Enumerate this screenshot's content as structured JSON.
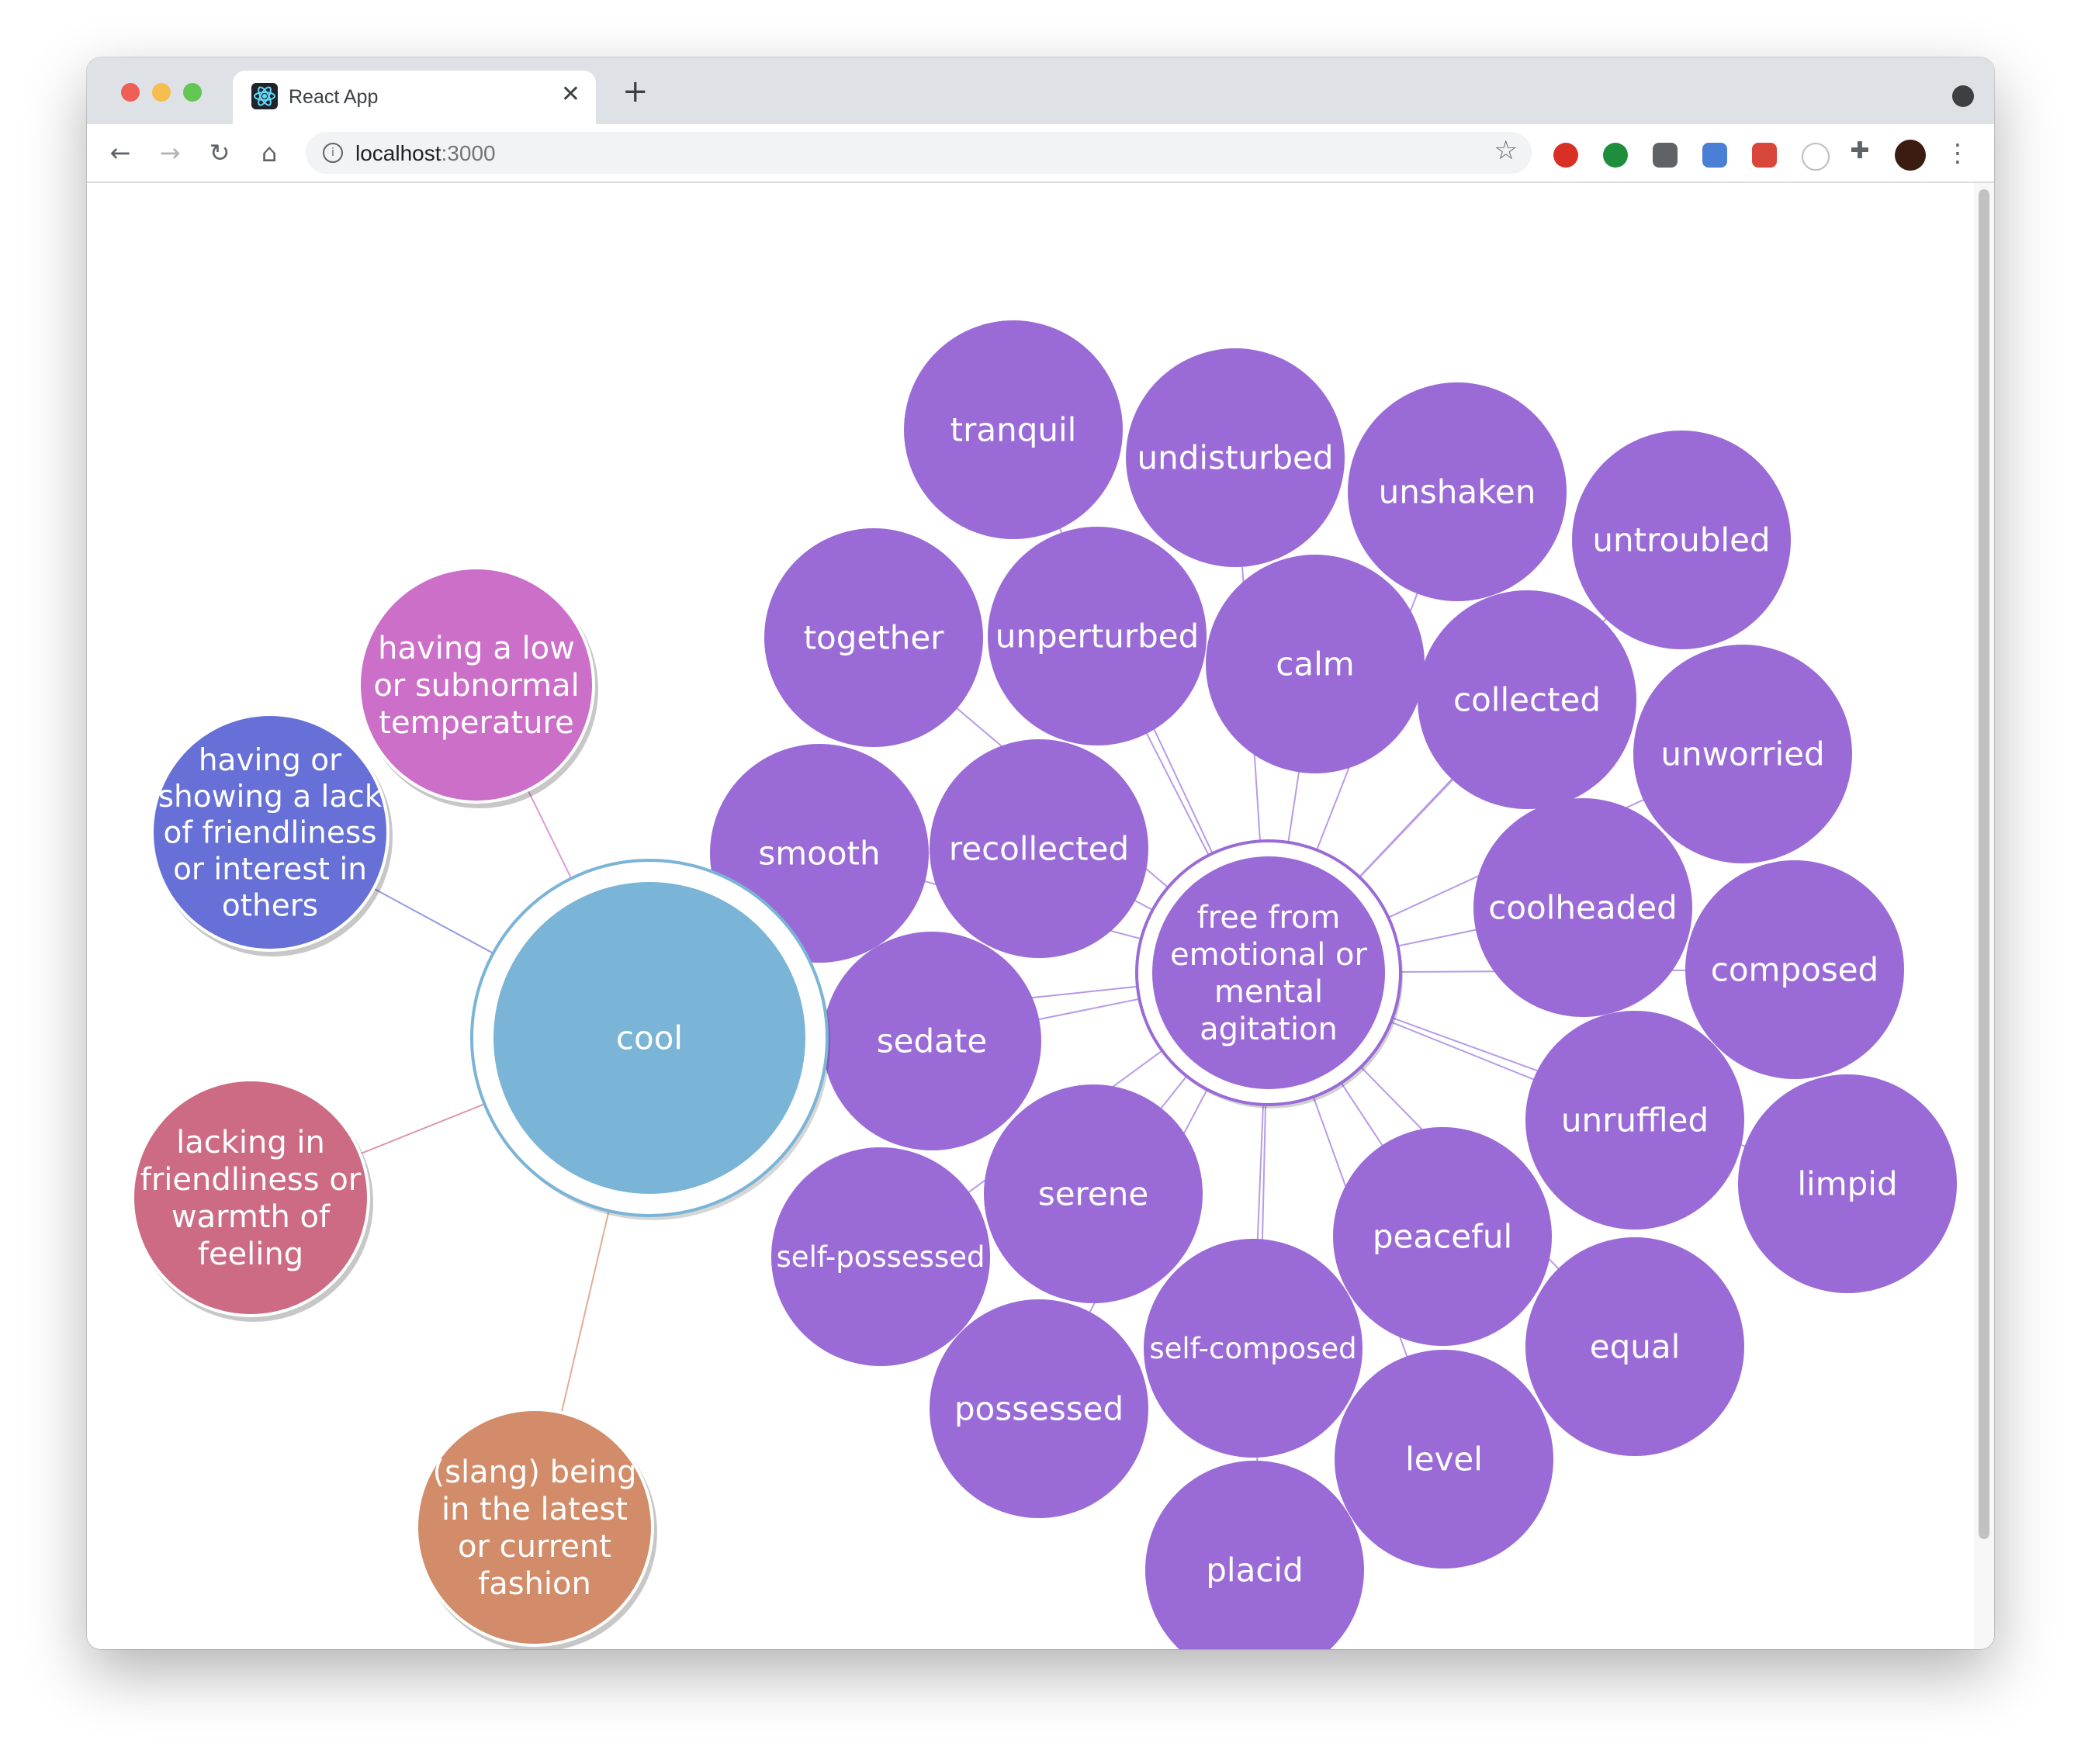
{
  "browser": {
    "tab_title": "React App",
    "url_host": "localhost",
    "url_port": ":3000"
  },
  "graph": {
    "root": {
      "label": "cool",
      "color": "#7ab4d6"
    },
    "senses": [
      {
        "id": "s-temp",
        "lines": [
          "having a low",
          "or subnormal",
          "temperature"
        ],
        "color": "#cc6fc9"
      },
      {
        "id": "s-lack",
        "lines": [
          "having or",
          "showing a lack",
          "of friendliness",
          "or interest in",
          "others"
        ],
        "color": "#6670d6"
      },
      {
        "id": "s-warm",
        "lines": [
          "lacking in",
          "friendliness or",
          "warmth of",
          "feeling"
        ],
        "color": "#cd6b84"
      },
      {
        "id": "s-slang",
        "lines": [
          "(slang) being",
          "in the latest",
          "or current",
          "fashion"
        ],
        "color": "#d38c69"
      },
      {
        "id": "s-calm",
        "lines": [
          "free from",
          "emotional or",
          "mental",
          "agitation"
        ],
        "color": "#9a6bd6"
      }
    ],
    "synonyms": [
      "tranquil",
      "undisturbed",
      "unshaken",
      "untroubled",
      "together",
      "unperturbed",
      "calm",
      "collected",
      "unworried",
      "smooth",
      "recollected",
      "coolheaded",
      "composed",
      "sedate",
      "unruffled",
      "limpid",
      "serene",
      "self-possessed",
      "peaceful",
      "equal",
      "self-composed",
      "possessed",
      "level",
      "placid"
    ],
    "synonym_color": "#9a6bd6"
  }
}
